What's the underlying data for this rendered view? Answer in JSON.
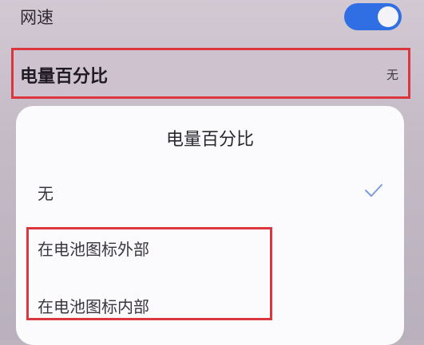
{
  "settings": {
    "network_speed_label": "网速",
    "network_speed_enabled": true,
    "battery_percentage_label": "电量百分比",
    "battery_percentage_value": "无"
  },
  "dialog": {
    "title": "电量百分比",
    "options": [
      {
        "label": "无",
        "selected": true
      },
      {
        "label": "在电池图标外部",
        "selected": false
      },
      {
        "label": "在电池图标内部",
        "selected": false
      }
    ]
  },
  "colors": {
    "toggle_on": "#2f6fe3",
    "highlight": "#d9363e",
    "check": "#7b9cd8"
  },
  "icons": {
    "checkmark": "check-icon"
  }
}
